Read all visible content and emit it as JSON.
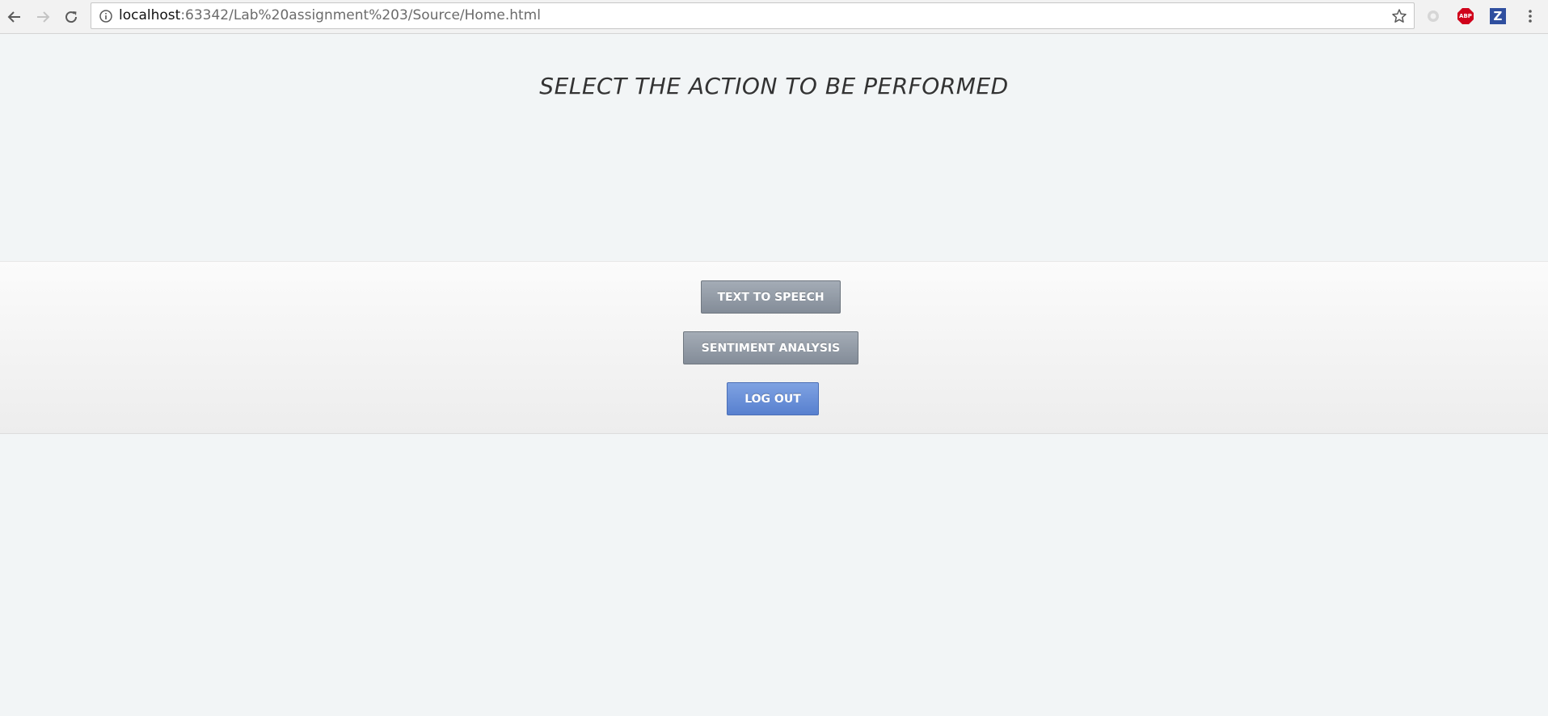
{
  "browser": {
    "url_host": "localhost",
    "url_path": ":63342/Lab%20assignment%203/Source/Home.html",
    "icons": {
      "back": "arrow-left-icon",
      "forward": "arrow-right-icon",
      "reload": "reload-icon",
      "info": "info-icon",
      "bookmark": "star-icon",
      "menu": "kebab-menu-icon"
    },
    "extensions": {
      "abp_label": "ABP",
      "z_label": "Z"
    }
  },
  "page": {
    "heading": "SELECT THE ACTION TO BE PERFORMED",
    "buttons": {
      "text_to_speech": "TEXT TO SPEECH",
      "sentiment_analysis": "SENTIMENT ANALYSIS",
      "log_out": "LOG OUT"
    },
    "colors": {
      "background": "#f2f5f6",
      "gray_button": "#8f98a4",
      "blue_button": "#6a91dc"
    }
  }
}
